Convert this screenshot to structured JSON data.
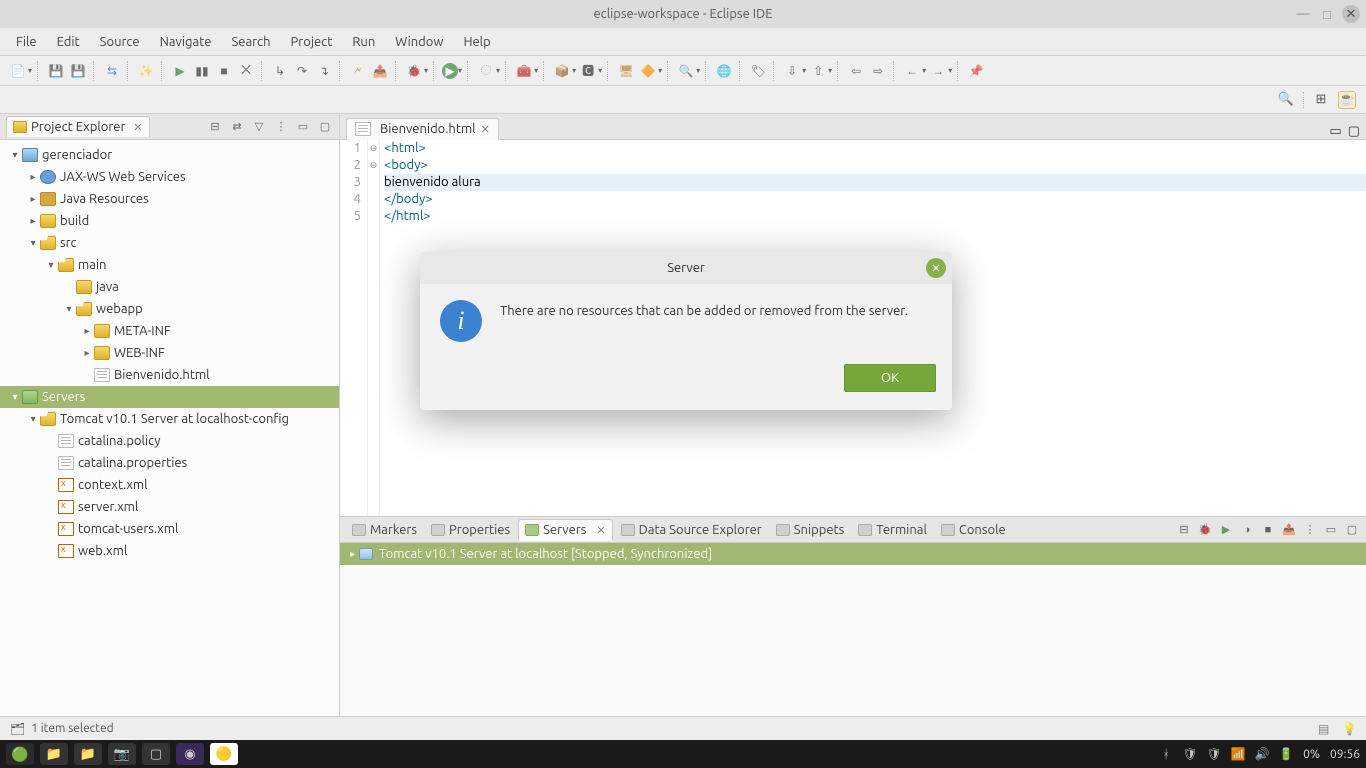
{
  "window": {
    "title": "eclipse-workspace - Eclipse IDE"
  },
  "menu": {
    "file": "File",
    "edit": "Edit",
    "source": "Source",
    "navigate": "Navigate",
    "search": "Search",
    "project": "Project",
    "run": "Run",
    "window": "Window",
    "help": "Help"
  },
  "explorer": {
    "title": "Project Explorer",
    "tree": {
      "project": "gerenciador",
      "jaxws": "JAX-WS Web Services",
      "javares": "Java Resources",
      "build": "build",
      "src": "src",
      "main": "main",
      "java": "java",
      "webapp": "webapp",
      "metainf": "META-INF",
      "webinf": "WEB-INF",
      "bienvenido": "Bienvenido.html",
      "servers": "Servers",
      "tomcatcfg": "Tomcat v10.1 Server at localhost-config",
      "catalinaPolicy": "catalina.policy",
      "catalinaProps": "catalina.properties",
      "contextXml": "context.xml",
      "serverXml": "server.xml",
      "tomcatUsersXml": "tomcat-users.xml",
      "webXml": "web.xml"
    }
  },
  "editor": {
    "tab": "Bienvenido.html",
    "lines": {
      "l1": "<html>",
      "l2": "<body>",
      "l3": "bienvenido alura",
      "l4": "</body>",
      "l5": "</html>"
    },
    "lineNumbers": {
      "n1": "1",
      "n2": "2",
      "n3": "3",
      "n4": "4",
      "n5": "5"
    }
  },
  "bottom": {
    "tabs": {
      "markers": "Markers",
      "properties": "Properties",
      "servers": "Servers",
      "dataSource": "Data Source Explorer",
      "snippets": "Snippets",
      "terminal": "Terminal",
      "console": "Console"
    },
    "serverRow": "Tomcat v10.1 Server at localhost  [Stopped, Synchronized]"
  },
  "dialog": {
    "title": "Server",
    "message": "There are no resources that can be added or removed from the server.",
    "ok": "OK"
  },
  "status": {
    "text": "1 item selected"
  },
  "taskbar": {
    "battery": "0%",
    "time": "09:56"
  }
}
